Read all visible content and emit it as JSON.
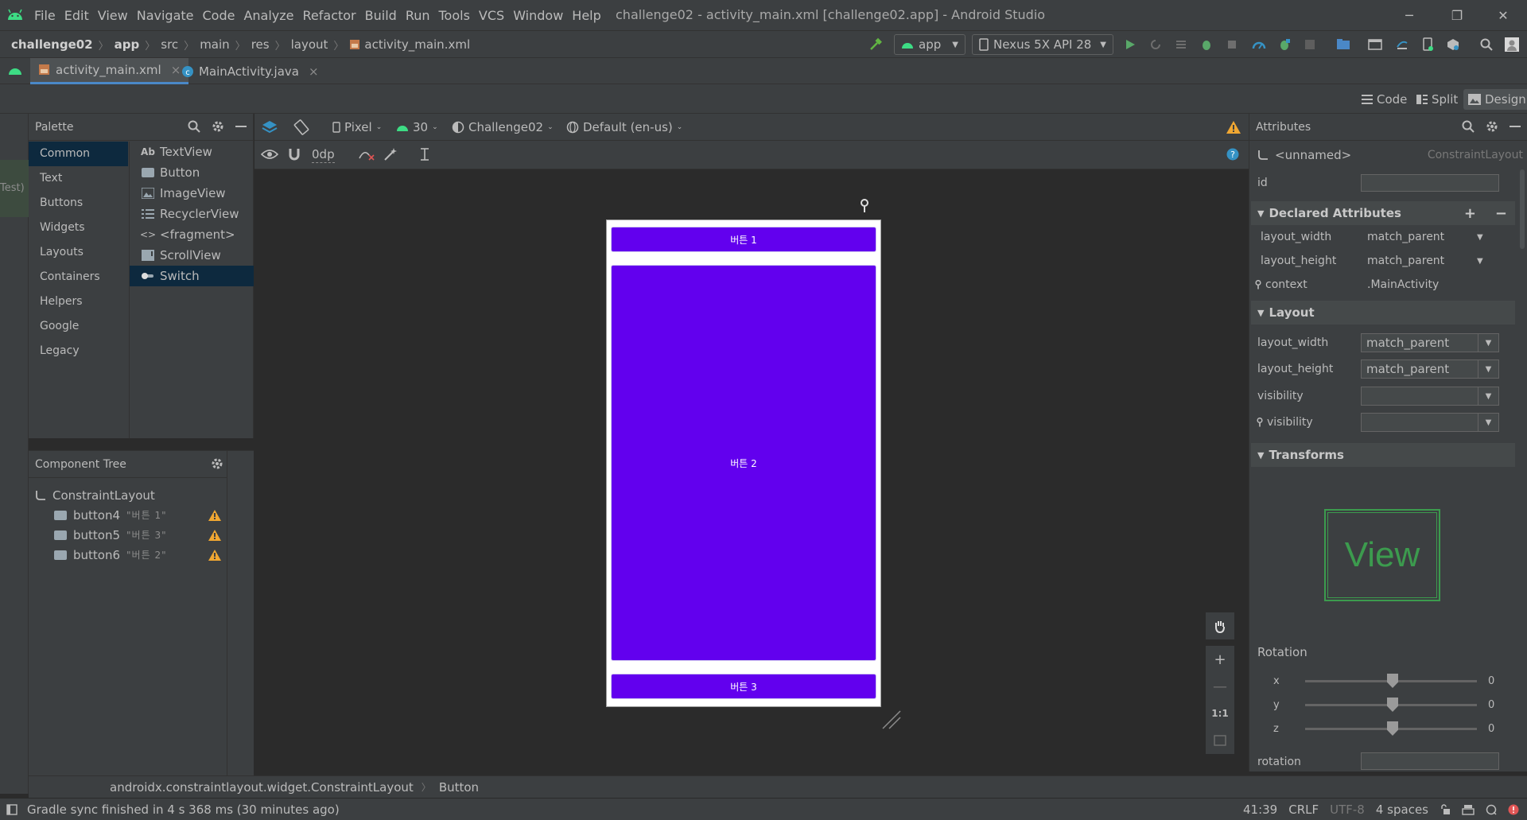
{
  "window": {
    "title": "challenge02 - activity_main.xml [challenge02.app] - Android Studio",
    "controls": {
      "minimize": "─",
      "restore": "❐",
      "close": "✕"
    }
  },
  "menu": [
    "File",
    "Edit",
    "View",
    "Navigate",
    "Code",
    "Analyze",
    "Refactor",
    "Build",
    "Run",
    "Tools",
    "VCS",
    "Window",
    "Help"
  ],
  "breadcrumb": [
    "challenge02",
    "app",
    "src",
    "main",
    "res",
    "layout",
    "activity_main.xml"
  ],
  "run_config": {
    "module": "app",
    "device": "Nexus 5X API 28"
  },
  "tabs": [
    {
      "label": "activity_main.xml",
      "close": "×"
    },
    {
      "label": "MainActivity.java",
      "close": "×"
    }
  ],
  "view_modes": {
    "code": "Code",
    "split": "Split",
    "design": "Design"
  },
  "left_strip_label": "Test)",
  "palette": {
    "title": "Palette",
    "categories": [
      "Common",
      "Text",
      "Buttons",
      "Widgets",
      "Layouts",
      "Containers",
      "Helpers",
      "Google",
      "Legacy"
    ],
    "items": [
      {
        "icon": "Ab",
        "label": "TextView"
      },
      {
        "icon": "",
        "label": "Button"
      },
      {
        "icon": "",
        "label": "ImageView"
      },
      {
        "icon": "",
        "label": "RecyclerView"
      },
      {
        "icon": "<>",
        "label": "<fragment>"
      },
      {
        "icon": "",
        "label": "ScrollView"
      },
      {
        "icon": "",
        "label": "Switch"
      }
    ]
  },
  "component_tree": {
    "title": "Component Tree",
    "root": "ConstraintLayout",
    "children": [
      {
        "id": "button4",
        "text": "\"버튼 1\""
      },
      {
        "id": "button5",
        "text": "\"버튼 3\""
      },
      {
        "id": "button6",
        "text": "\"버튼 2\""
      }
    ]
  },
  "design_toolbar": {
    "device": "Pixel",
    "api": "30",
    "theme": "Challenge02",
    "locale": "Default (en-us)",
    "margin": "0dp"
  },
  "preview": {
    "buttons": [
      "버튼 1",
      "버튼 2",
      "버튼 3"
    ],
    "accent": "#6200ee"
  },
  "zoom": {
    "plus": "+",
    "minus": "—",
    "one_to_one": "1:1"
  },
  "attributes": {
    "title": "Attributes",
    "component_name": "<unnamed>",
    "component_type": "ConstraintLayout",
    "id_label": "id",
    "declared_title": "Declared Attributes",
    "declared": [
      {
        "key": "layout_width",
        "value": "match_parent"
      },
      {
        "key": "layout_height",
        "value": "match_parent"
      },
      {
        "key": "context",
        "value": ".MainActivity"
      }
    ],
    "layout_title": "Layout",
    "layout": [
      {
        "key": "layout_width",
        "value": "match_parent"
      },
      {
        "key": "layout_height",
        "value": "match_parent"
      },
      {
        "key": "visibility",
        "value": ""
      },
      {
        "key": "visibility",
        "value": ""
      }
    ],
    "transforms_title": "Transforms",
    "view_preview": "View",
    "rotation_title": "Rotation",
    "rotation_axes": [
      {
        "axis": "x",
        "value": "0"
      },
      {
        "axis": "y",
        "value": "0"
      },
      {
        "axis": "z",
        "value": "0"
      }
    ],
    "rotation_label": "rotation"
  },
  "component_breadcrumb": [
    "androidx.constraintlayout.widget.ConstraintLayout",
    "Button"
  ],
  "status": {
    "message": "Gradle sync finished in 4 s 368 ms (30 minutes ago)",
    "position": "41:39",
    "line_sep": "CRLF",
    "encoding": "UTF-8",
    "indent": "4 spaces"
  }
}
